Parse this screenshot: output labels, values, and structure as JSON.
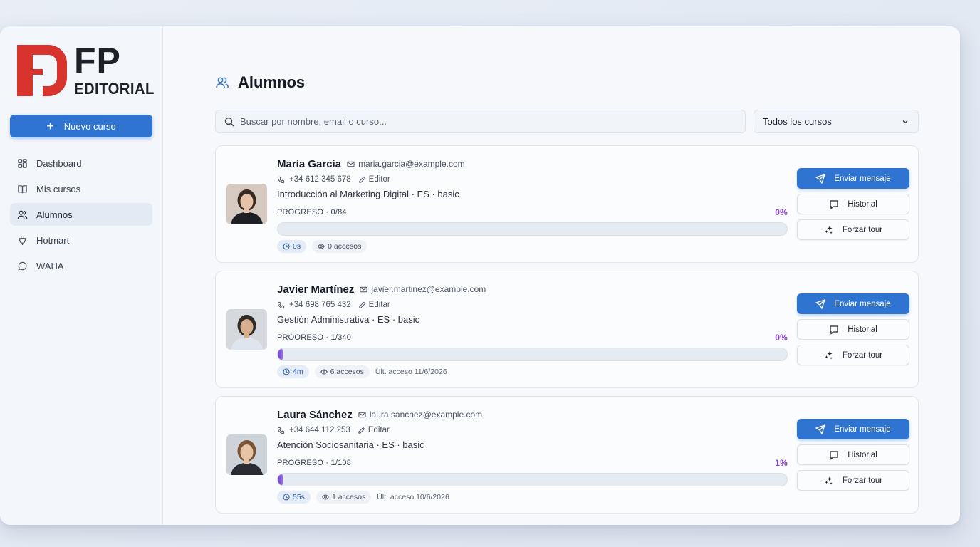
{
  "brand": {
    "logo_fp": "FP",
    "logo_editorial": "EDITORIAL",
    "colors": {
      "mark": "#d9332d",
      "accent": "#2f74d0",
      "progress": "#8a3fd6"
    }
  },
  "sidebar": {
    "new_course_label": "Nuevo curso",
    "items": [
      {
        "label": "Dashboard",
        "icon": "dashboard-icon",
        "active": false
      },
      {
        "label": "Mis cursos",
        "icon": "book-icon",
        "active": false
      },
      {
        "label": "Alumnos",
        "icon": "users-icon",
        "active": true
      },
      {
        "label": "Hotmart",
        "icon": "plug-icon",
        "active": false
      },
      {
        "label": "WAHA",
        "icon": "chat-icon",
        "active": false
      }
    ]
  },
  "main": {
    "title": "Alumnos",
    "search_placeholder": "Buscar por nombre, email o curso...",
    "course_filter": "Todos los cursos"
  },
  "students": [
    {
      "name": "María García",
      "email": "maria.garcia@example.com",
      "phone": "+34 612 345 678",
      "edit_label": "Editor",
      "course": "Introducción al Marketing Digital · ES · basic",
      "progress_label": "PROGRESO · 0/84",
      "percent_text": "0%",
      "progress_fraction": 0,
      "time": "0s",
      "accesses": "0 accesos",
      "last_access": ""
    },
    {
      "name": "Javier Martínez",
      "email": "javier.martinez@example.com",
      "phone": "+34 698 765 432",
      "edit_label": "Editar",
      "course": "Gestión Administrativa · ES · basic",
      "progress_label": "PROORESO · 1/340",
      "percent_text": "0%",
      "progress_fraction": 0.003,
      "time": "4m",
      "accesses": "6 accesos",
      "last_access": "Últ. acceso 11/6/2026"
    },
    {
      "name": "Laura Sánchez",
      "email": "laura.sanchez@example.com",
      "phone": "+34 644 112 253",
      "edit_label": "Editar",
      "course": "Atención Sociosanitaria · ES · basic",
      "progress_label": "PROGRESO · 1/108",
      "percent_text": "1%",
      "progress_fraction": 0.01,
      "time": "55s",
      "accesses": "1 accesos",
      "last_access": "Últ. acceso 10/6/2026"
    }
  ],
  "actions": {
    "send": "Enviar mensaje",
    "history": "Historial",
    "tour": "Forzar tour"
  }
}
